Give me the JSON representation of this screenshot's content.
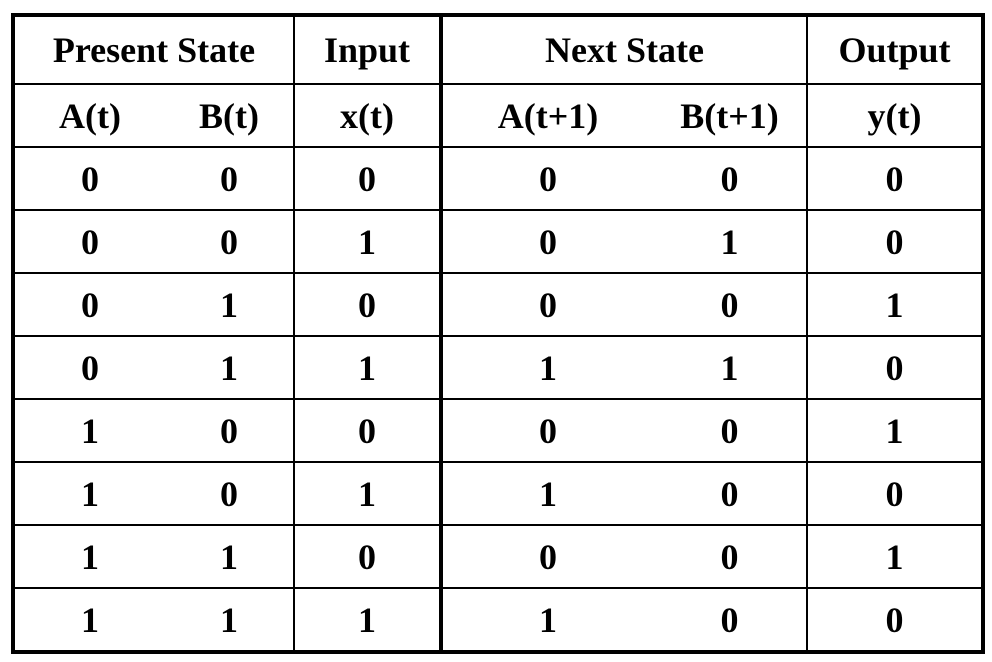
{
  "table": {
    "group_headers": [
      "Present State",
      "Input",
      "Next State",
      "Output"
    ],
    "column_headers": [
      "A(t)",
      "B(t)",
      "x(t)",
      "A(t+1)",
      "B(t+1)",
      "y(t)"
    ],
    "rows": [
      [
        "0",
        "0",
        "0",
        "0",
        "0",
        "0"
      ],
      [
        "0",
        "0",
        "1",
        "0",
        "1",
        "0"
      ],
      [
        "0",
        "1",
        "0",
        "0",
        "0",
        "1"
      ],
      [
        "0",
        "1",
        "1",
        "1",
        "1",
        "0"
      ],
      [
        "1",
        "0",
        "0",
        "0",
        "0",
        "1"
      ],
      [
        "1",
        "0",
        "1",
        "1",
        "0",
        "0"
      ],
      [
        "1",
        "1",
        "0",
        "0",
        "0",
        "1"
      ],
      [
        "1",
        "1",
        "1",
        "1",
        "0",
        "0"
      ]
    ]
  }
}
